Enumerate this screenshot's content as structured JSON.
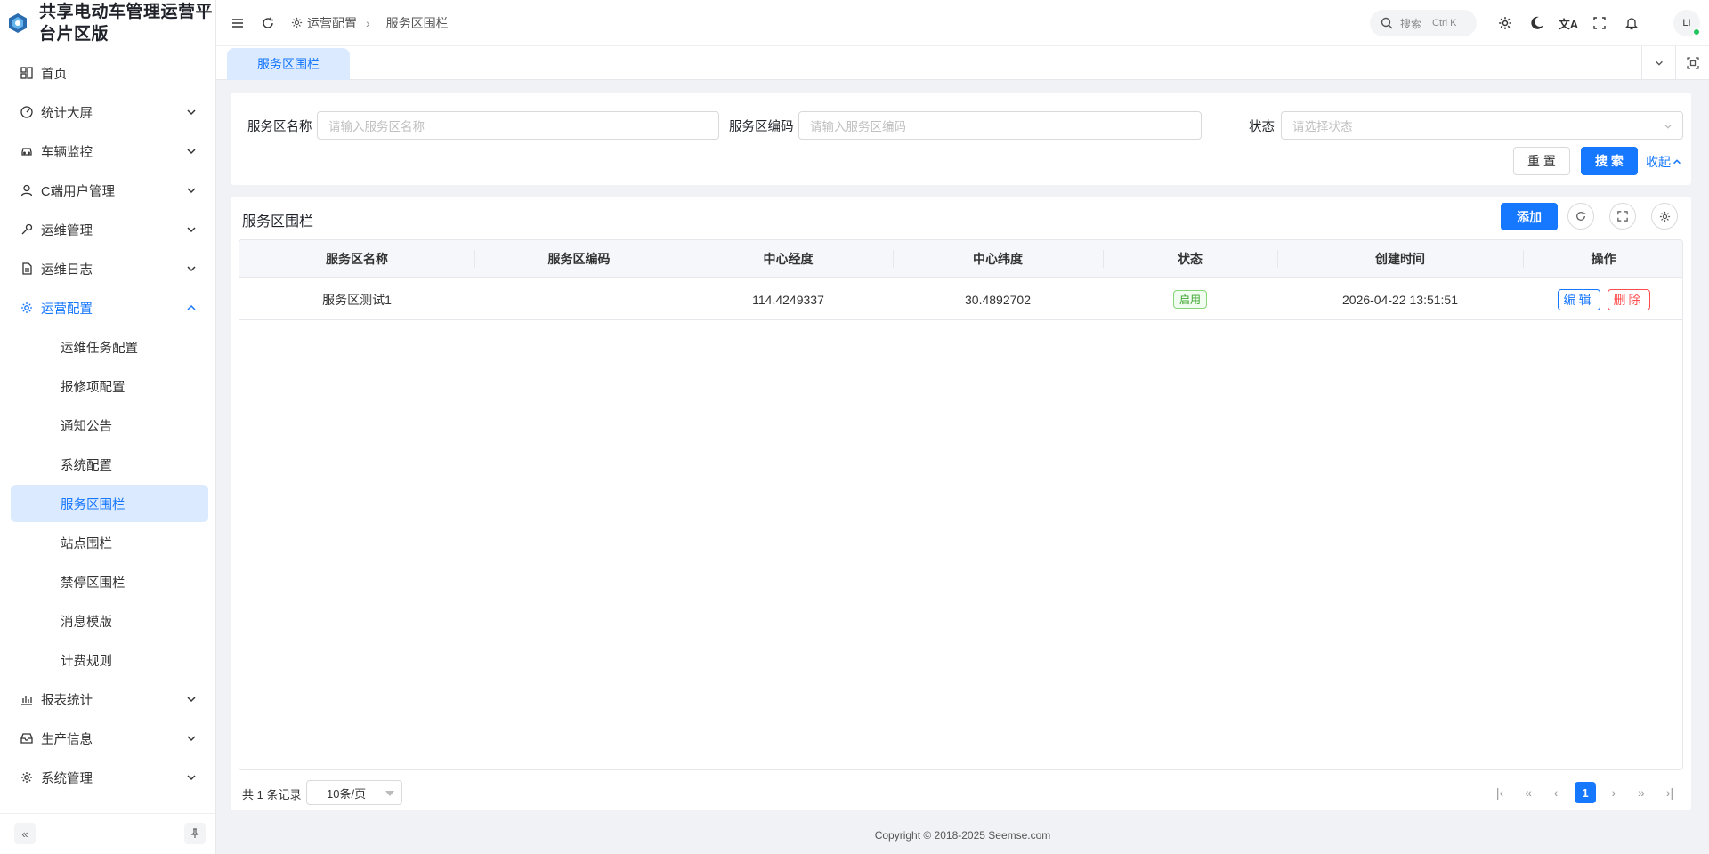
{
  "app": {
    "title": "共享电动车管理运营平台片区版"
  },
  "sidebar": {
    "items": [
      {
        "label": "首页",
        "icon": "home-icon"
      },
      {
        "label": "统计大屏",
        "icon": "dashboard-icon"
      },
      {
        "label": "车辆监控",
        "icon": "car-icon"
      },
      {
        "label": "C端用户管理",
        "icon": "user-icon"
      },
      {
        "label": "运维管理",
        "icon": "wrench-icon"
      },
      {
        "label": "运维日志",
        "icon": "document-icon"
      },
      {
        "label": "运营配置",
        "icon": "gear-icon"
      },
      {
        "label": "报表统计",
        "icon": "bar-chart-icon"
      },
      {
        "label": "生产信息",
        "icon": "inbox-icon"
      },
      {
        "label": "系统管理",
        "icon": "gear-icon"
      }
    ],
    "sub_items": [
      {
        "label": "运维任务配置"
      },
      {
        "label": "报修项配置"
      },
      {
        "label": "通知公告"
      },
      {
        "label": "系统配置"
      },
      {
        "label": "服务区围栏"
      },
      {
        "label": "站点围栏"
      },
      {
        "label": "禁停区围栏"
      },
      {
        "label": "消息模版"
      },
      {
        "label": "计费规则"
      }
    ]
  },
  "header": {
    "breadcrumb": [
      "运营配置",
      "服务区围栏"
    ],
    "search_label": "搜索",
    "search_shortcut": "Ctrl K",
    "avatar_text": "LI"
  },
  "tabs": [
    {
      "label": "服务区围栏"
    }
  ],
  "filters": {
    "name_label": "服务区名称",
    "name_placeholder": "请输入服务区名称",
    "code_label": "服务区编码",
    "code_placeholder": "请输入服务区编码",
    "status_label": "状态",
    "status_placeholder": "请选择状态",
    "reset_label": "重 置",
    "search_label": "搜 索",
    "collapse_label": "收起"
  },
  "table": {
    "title": "服务区围栏",
    "add_label": "添加",
    "columns": [
      "服务区名称",
      "服务区编码",
      "中心经度",
      "中心纬度",
      "状态",
      "创建时间",
      "操作"
    ],
    "rows": [
      {
        "name": "服务区测试1",
        "code": "",
        "lng": "114.4249337",
        "lat": "30.4892702",
        "status": "启用",
        "created": "2026-04-22 13:51:51",
        "edit": "编辑",
        "delete": "删除"
      }
    ]
  },
  "pagination": {
    "total_text": "共 1 条记录",
    "page_size": "10条/页",
    "current_page": "1"
  },
  "footer": {
    "copyright": "Copyright © 2018-2025 Seemse.com"
  },
  "colors": {
    "primary": "#1677ff",
    "danger": "#ff4d4f",
    "success": "#3da52f"
  }
}
